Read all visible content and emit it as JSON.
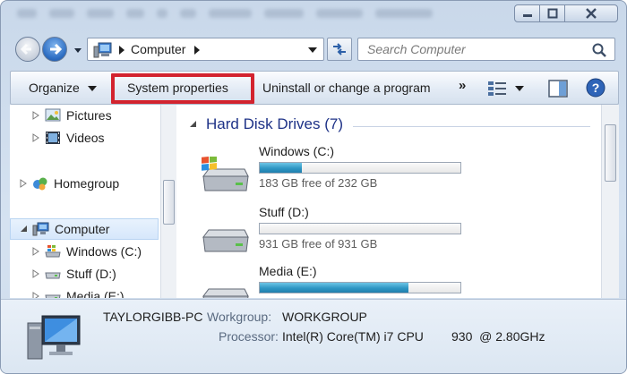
{
  "window": {
    "controls": [
      "minimize",
      "maximize",
      "close"
    ]
  },
  "address": {
    "location": "Computer",
    "search_placeholder": "Search Computer"
  },
  "commandbar": {
    "organize_label": "Organize",
    "system_properties_label": "System properties",
    "uninstall_label": "Uninstall or change a program",
    "more_label": "»",
    "highlight_color": "#d3232e"
  },
  "navpane": {
    "items": [
      {
        "label": "Pictures",
        "icon": "pictures-icon"
      },
      {
        "label": "Videos",
        "icon": "videos-icon"
      },
      {
        "label": "Homegroup",
        "icon": "homegroup-icon"
      },
      {
        "label": "Computer",
        "icon": "computer-icon",
        "selected": true
      },
      {
        "label": "Windows (C:)",
        "icon": "windows-drive-icon"
      },
      {
        "label": "Stuff (D:)",
        "icon": "drive-icon"
      },
      {
        "label": "Media (E:)",
        "icon": "drive-icon"
      }
    ]
  },
  "content": {
    "group_title": "Hard Disk Drives (7)",
    "drives": [
      {
        "label": "Windows (C:)",
        "free_text": "183 GB free of 232 GB",
        "used_fraction": 0.21
      },
      {
        "label": "Stuff (D:)",
        "free_text": "931 GB free of 931 GB",
        "used_fraction": 0.0
      },
      {
        "label": "Media (E:)",
        "free_text": "",
        "used_fraction": 0.74
      }
    ]
  },
  "details": {
    "pc_name": "TAYLORGIBB-PC",
    "workgroup_label": "Workgroup:",
    "workgroup_value": "WORKGROUP",
    "processor_label": "Processor:",
    "processor_value": "Intel(R) Core(TM) i7 CPU        930  @ 2.80GHz"
  },
  "colors": {
    "accent": "#1e3287",
    "progress_fill": "#2f97c4"
  }
}
